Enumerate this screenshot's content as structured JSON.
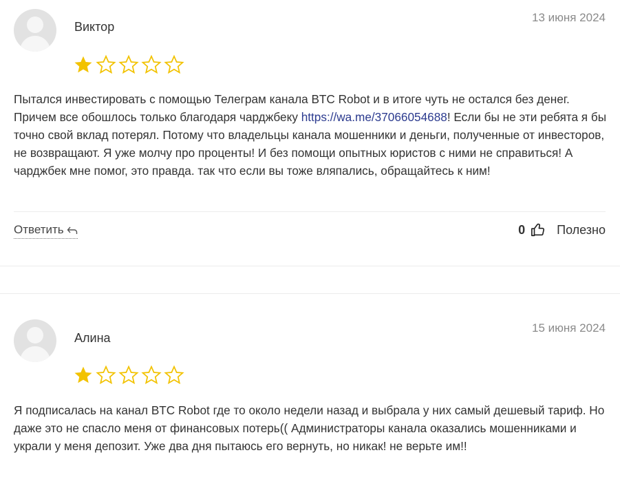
{
  "reviews": [
    {
      "author": "Виктор",
      "date": "13 июня 2024",
      "rating": 1,
      "max_rating": 5,
      "text_before_link": "Пытался инвестировать с помощью Телеграм канала BTC Robot и в итоге чуть не остался без денег. Причем все обошлось только благодаря чарджбеку ",
      "link": "https://wa.me/37066054688",
      "text_after_link": "! Если бы не эти ребята я бы точно свой вклад потерял. Потому что владельцы канала мошенники и деньги, полученные от инвесторов, не возвращают. Я уже молчу про проценты! И без помощи опытных юристов с ними не справиться! А чарджбек мне помог, это правда. так что если вы тоже вляпались, обращайтесь к ним!",
      "reply_label": "Ответить",
      "helpful_count": "0",
      "helpful_label": "Полезно"
    },
    {
      "author": "Алина",
      "date": "15 июня 2024",
      "rating": 1,
      "max_rating": 5,
      "text": "Я подписалась на канал BTC Robot где то около недели назад и выбрала у них самый дешевый тариф. Но даже это не спасло меня от финансовых потерь(( Администраторы канала оказались мошенниками и украли у меня депозит. Уже два дня пытаюсь его вернуть, но никак! не верьте им!!"
    }
  ],
  "colors": {
    "star_filled": "#f2c200",
    "star_empty": "#f2c200",
    "link": "#2c3b8f"
  }
}
